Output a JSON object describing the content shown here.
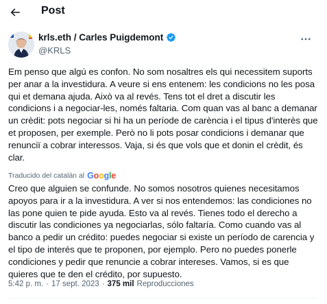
{
  "header": {
    "title": "Post"
  },
  "author": {
    "display_name": "krls.eth / Carles Puigdemont",
    "handle": "@KRLS"
  },
  "tweet": {
    "text": "Em penso que algú es confon. No som nosaltres els qui necessitem suports per anar a la investidura. A veure si ens entenem: les condicions no les posa qui et demana ajuda. Això va al revés. Tens tot el dret a discutir les condicions i a negociar-les, només faltaria. Com quan vas al banc a demanar un crèdit: pots negociar si hi ha un període de carència i el tipus d'interès que et proposen, per exemple. Però no li pots posar condicions i demanar que renunciï a cobrar interessos. Vaja, si és que vols que et donin el crèdit, és clar.",
    "translate_label": "Traducido del catalán al",
    "translate_provider": "Google",
    "translated_text": "Creo que alguien se confunde. No somos nosotros quienes necesitamos apoyos para ir a la investidura. A ver si nos entendemos: las condiciones no las pone quien te pide ayuda. Esto va al revés. Tienes todo el derecho a discutir las condiciones ya negociarlas, sólo faltaría. Como cuando vas al banco a pedir un crédito: puedes negociar si existe un período de carencia y el tipo de interés que te proponen, por ejemplo. Pero no puedes ponerle condiciones y pedir que renuncie a cobrar intereses. Vamos, si es que quieres que te den el crédito, por supuesto.",
    "time": "5:42 p. m.",
    "separator": "·",
    "date": "17 sept. 2023",
    "views_count": "375 mil",
    "views_label": "Reproducciones"
  },
  "icons": {
    "back": "back-arrow-icon",
    "verified": "verified-badge-icon",
    "more": "more-horizontal-icon"
  },
  "colors": {
    "verified": "#1d9bf0",
    "secondary_text": "#536471",
    "primary_text": "#0f1419"
  }
}
